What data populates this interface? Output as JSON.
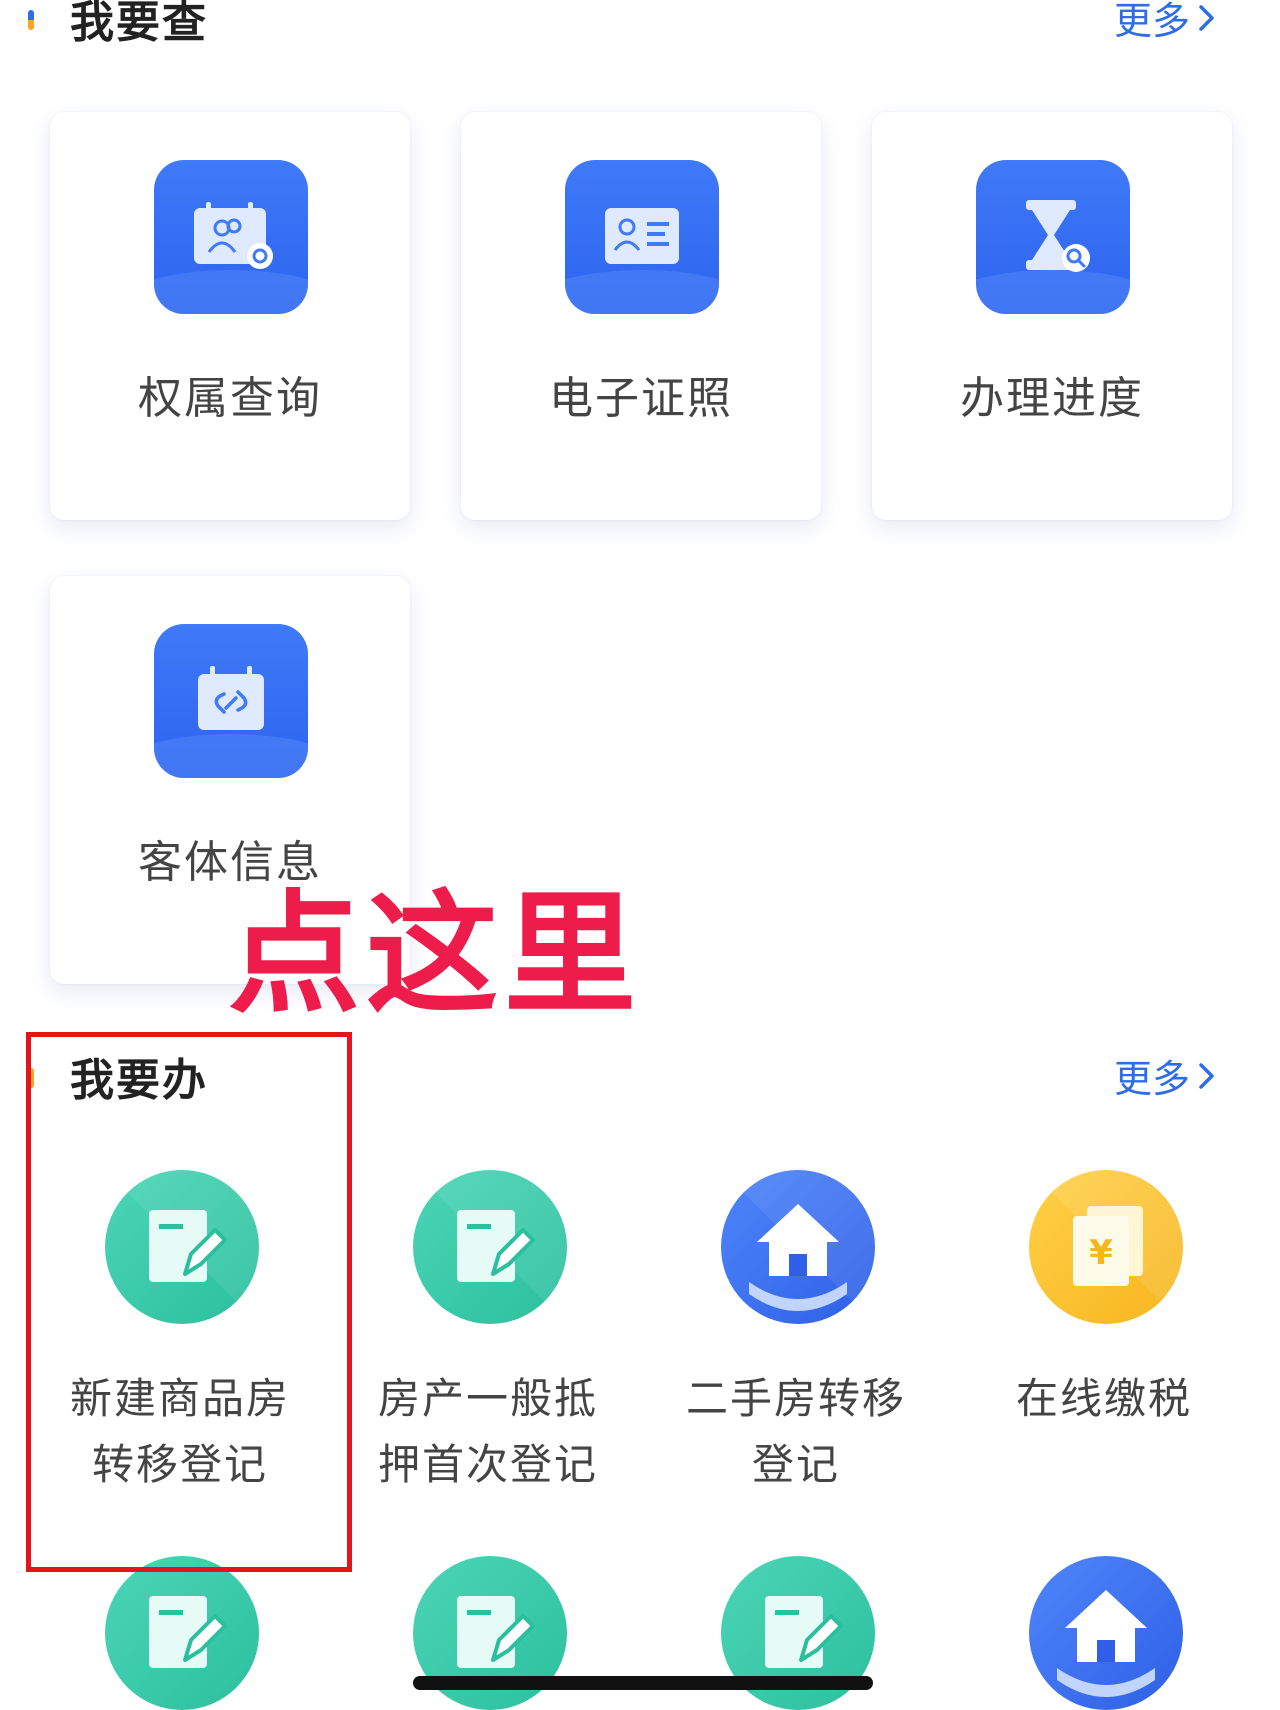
{
  "query_section": {
    "title": "我要查",
    "more_label": "更多",
    "accent_color": "#2e6ce9",
    "cards": [
      {
        "label": "权属查询",
        "icon": "user-certificate-search-icon"
      },
      {
        "label": "电子证照",
        "icon": "id-card-icon"
      },
      {
        "label": "办理进度",
        "icon": "hourglass-search-icon"
      },
      {
        "label": "客体信息",
        "icon": "calendar-link-icon"
      }
    ]
  },
  "handle_section": {
    "title": "我要办",
    "more_label": "更多",
    "accent_color": "#f5a623",
    "items": [
      {
        "label": "新建商品房转移登记",
        "icon": "edit-document-icon",
        "color": "#2bbf9e"
      },
      {
        "label": "房产一般抵押首次登记",
        "icon": "edit-document-icon",
        "color": "#2bbf9e"
      },
      {
        "label": "二手房转移登记",
        "icon": "house-hand-icon",
        "color": "#2e5fe6"
      },
      {
        "label": "在线缴税",
        "icon": "yuan-documents-icon",
        "color": "#f7b51e"
      }
    ],
    "partial_row_icons": [
      "edit-document-icon",
      "edit-document-icon",
      "edit-document-icon",
      "house-hand-icon"
    ]
  },
  "annotation": {
    "text": "点这里",
    "color": "#ee1c4a",
    "box_color": "#e3141c"
  }
}
